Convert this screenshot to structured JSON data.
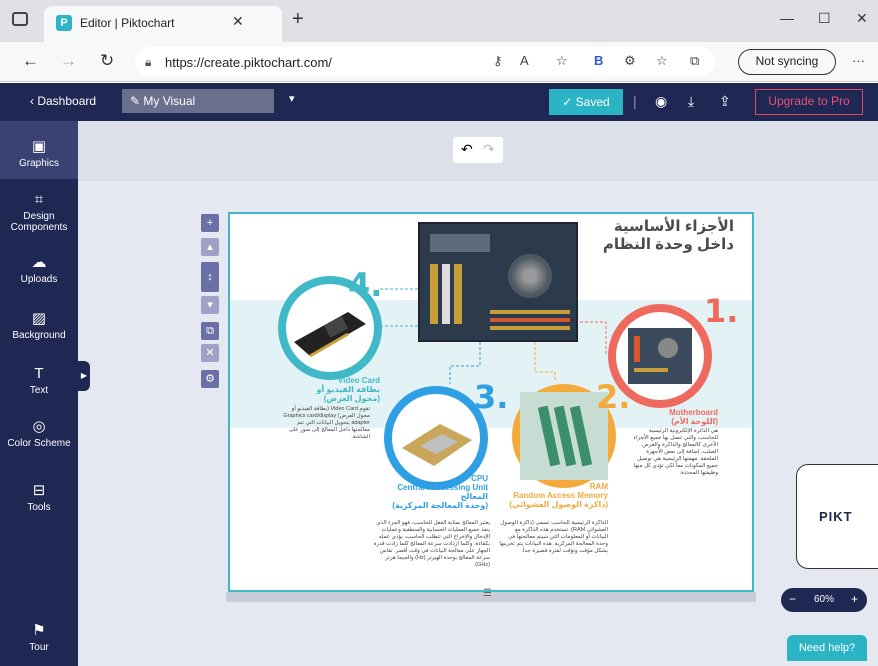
{
  "browser": {
    "tab_title": "Editor | Piktochart",
    "url": "https://create.piktochart.com/",
    "profile_button": "Not syncing",
    "bing_label": "B"
  },
  "header": {
    "back_label": "‹ Dashboard",
    "visual_name": "My Visual",
    "saved_label": "✓ Saved",
    "upgrade_label": "Upgrade to Pro"
  },
  "sidebar": {
    "items": [
      {
        "label": "Graphics",
        "icon": "image-icon"
      },
      {
        "label": "Design Components",
        "icon": "components-icon"
      },
      {
        "label": "Uploads",
        "icon": "upload-cloud-icon"
      },
      {
        "label": "Background",
        "icon": "background-icon"
      },
      {
        "label": "Text",
        "icon": "text-icon"
      },
      {
        "label": "Color Scheme",
        "icon": "palette-icon"
      },
      {
        "label": "Tools",
        "icon": "toolbox-icon"
      },
      {
        "label": "Tour",
        "icon": "signpost-icon"
      }
    ]
  },
  "infographic": {
    "title_line1": "الأجزاء الأساسية",
    "title_line2": "داخل وحدة النظام",
    "parts": [
      {
        "number": "1.",
        "color": "#ef6a5e",
        "name_en": "Motherboard",
        "name_ar": "(اللوحة الأم)",
        "desc": "هي الدائرة الإلكترونية الرئيسية للحاسب، والتي تتصل بها جميع الأجزاء الأخرى كالمعالج والذاكرة والقرص الصلب، إضافة إلى بعض الأجهزة الملحقة. مهمتها الرئيسية هي توصيل جميع المكونات معاً لكي تؤدي كل منها وظيفتها المحددة."
      },
      {
        "number": "2.",
        "color": "#f4a93a",
        "name_en": "RAM",
        "name_en2": "Random Access Memory",
        "name_ar": "(ذاكرة الوصول العشوائي)",
        "desc": "الذاكرة الرئيسية للحاسب تسمى (ذاكرة الوصول العشوائي RAM). تستخدم هذه الذاكرة مع البيانات أو المعلومات التي سيتم معالجتها في وحدة المعالجة المركزية. هذه البيانات يتم تخزينها بشكل مؤقت وتؤقت لفترة قصيرة جداً."
      },
      {
        "number": "3.",
        "color": "#2f9fe4",
        "name_en": "CPU",
        "name_en2": "Central Processing Unit",
        "name_ar1": "المعالج",
        "name_ar": "(وحدة المعالجة المركزية)",
        "desc": "يعتبر المعالج بمثابة العقل للحاسب، فهو الجزء الذي ينفذ جميع العمليات الحسابية والمنطقية وعمليات الإدخال والإخراج التي تتطلب الحاسب، يؤدي عمله بكفاءة. وكلما ازدادت سرعة المعالج كلما زادت قدرة الجهاز على معالجة البيانات في وقت أقصر. تقاس سرعة المعالج بوحدة الهيرتز (Hz) والجيجا هرتز (GHz)."
      },
      {
        "number": "4.",
        "color": "#3fb8c8",
        "name_en": "Video Card",
        "name_ar": "بطاقة الفيديو أو (محول العرض)",
        "desc": "تقوم Video Card (بطاقة الفيديو أو محول العرض) Graphics card/display adapter بتحويل البيانات التي تتم معالجتها داخل المعالج إلى صور على الشاشة."
      }
    ]
  },
  "widgets": {
    "pikto_label": "PIKT",
    "zoom_value": "60%",
    "help_label": "Need help?"
  }
}
